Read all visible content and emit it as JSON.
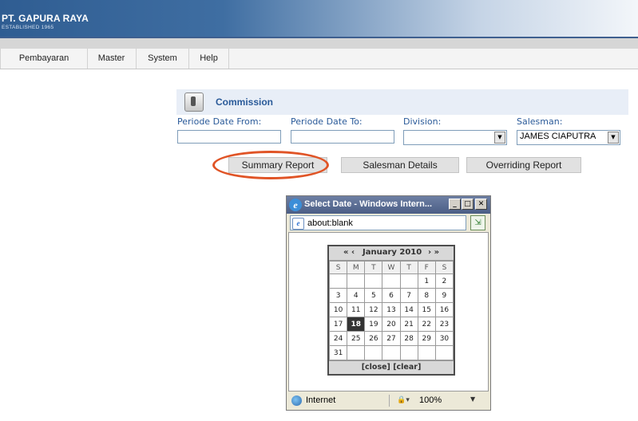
{
  "header": {
    "brand_name": "PT. GAPURA RAYA",
    "brand_sub": "ESTABLISHED 1965"
  },
  "menu": {
    "items": [
      "Pembayaran",
      "Master",
      "System",
      "Help"
    ]
  },
  "commission": {
    "title": "Commission",
    "labels": {
      "date_from": "Periode Date From:",
      "date_to": "Periode Date To:",
      "division": "Division:",
      "salesman": "Salesman:"
    },
    "fields": {
      "date_from": "",
      "date_to": "",
      "division": "",
      "salesman": "JAMES CIAPUTRA"
    },
    "buttons": {
      "summary": "Summary Report",
      "salesman_details": "Salesman Details",
      "overriding": "Overriding Report"
    },
    "highlight_color": "#e05426"
  },
  "popup": {
    "title": "Select Date - Windows Intern...",
    "address": "about:blank",
    "calendar": {
      "nav_prev": "« ‹",
      "month_year": "January 2010",
      "nav_next": "› »",
      "days_of_week": [
        "S",
        "M",
        "T",
        "W",
        "T",
        "F",
        "S"
      ],
      "weeks": [
        [
          "",
          "",
          "",
          "",
          "",
          "1",
          "2"
        ],
        [
          "3",
          "4",
          "5",
          "6",
          "7",
          "8",
          "9"
        ],
        [
          "10",
          "11",
          "12",
          "13",
          "14",
          "15",
          "16"
        ],
        [
          "17",
          "18",
          "19",
          "20",
          "21",
          "22",
          "23"
        ],
        [
          "24",
          "25",
          "26",
          "27",
          "28",
          "29",
          "30"
        ],
        [
          "31",
          "",
          "",
          "",
          "",
          "",
          ""
        ]
      ],
      "selected_day": "18",
      "footer": "[close] [clear]"
    },
    "status": {
      "zone": "Internet",
      "zoom": "100%"
    }
  }
}
